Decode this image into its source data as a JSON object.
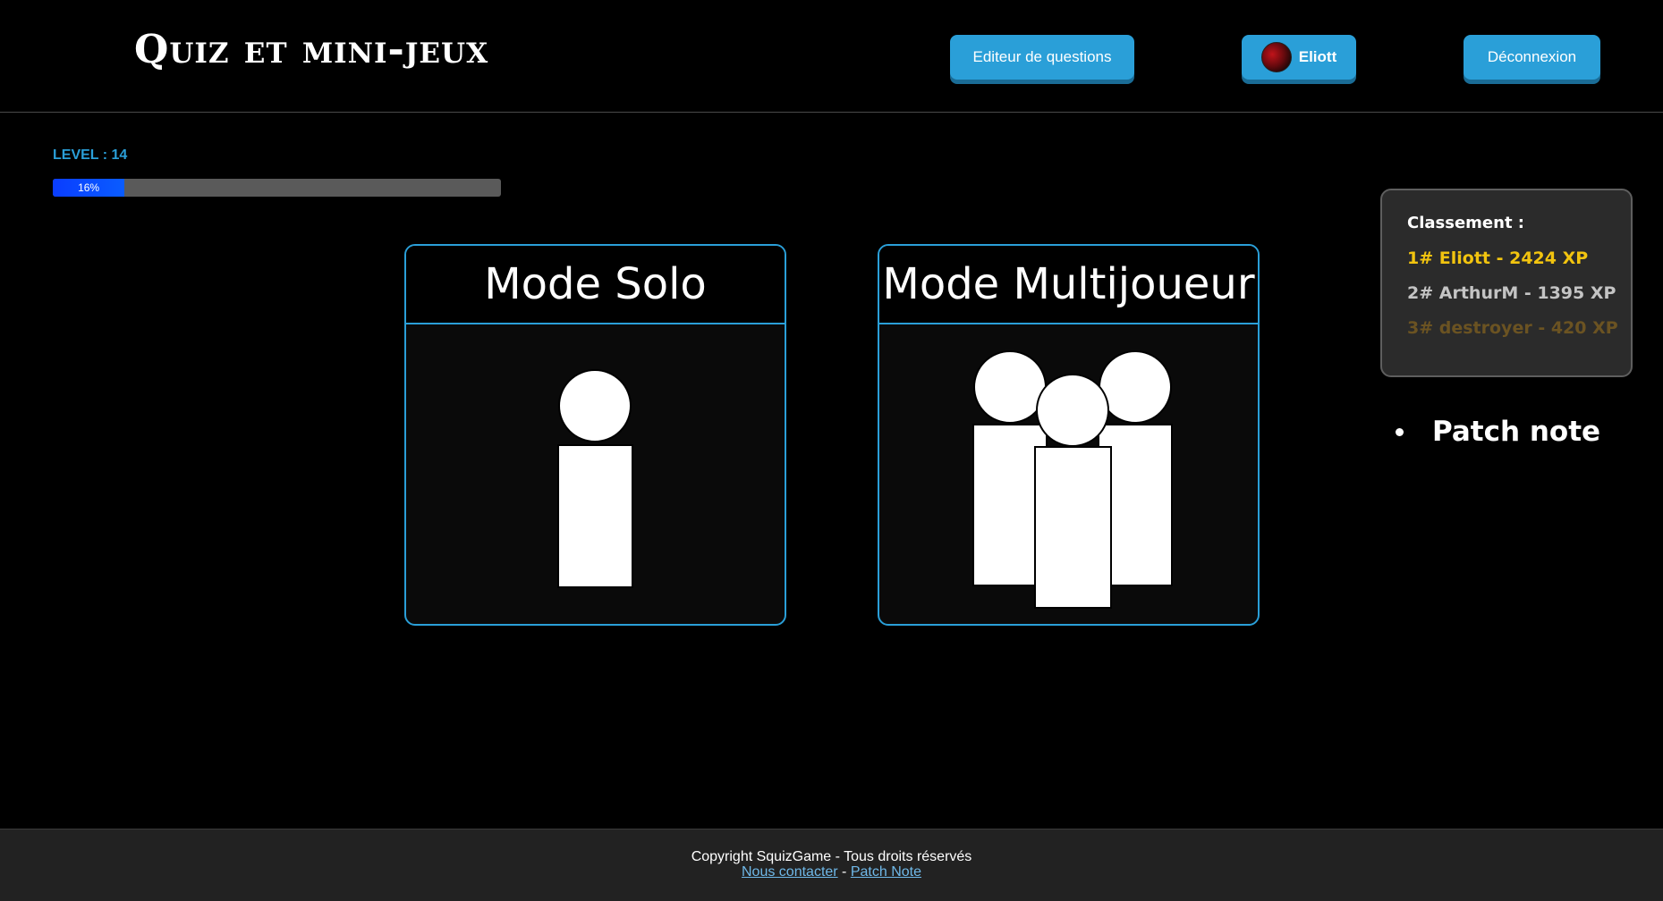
{
  "header": {
    "logo": "Quiz et mini-jeux",
    "editor_button": "Editeur de questions",
    "user_button": "Eliott",
    "logout_button": "Déconnexion"
  },
  "level": {
    "label": "LEVEL : 14",
    "progress_percent": 16,
    "progress_label": "16%"
  },
  "modes": {
    "solo": {
      "title": "Mode Solo",
      "icon": "person-icon"
    },
    "multi": {
      "title": "Mode Multijoueur",
      "icon": "group-icon"
    }
  },
  "ranking": {
    "title": "Classement :",
    "entries": [
      {
        "text": "1# Eliott - 2424 XP",
        "color": "#f2c40f"
      },
      {
        "text": "2# ArthurM - 1395 XP",
        "color": "#c4c4c4"
      },
      {
        "text": "3# destroyer - 420 XP",
        "color": "#6b5322"
      }
    ]
  },
  "patch_note": "Patch note",
  "footer": {
    "copyright": "Copyright SquizGame - Tous droits réservés",
    "contact_link": "Nous contacter",
    "separator": " - ",
    "patch_link": "Patch Note"
  },
  "colors": {
    "accent": "#2a9fd8",
    "progress_fill": "#0a4dff"
  }
}
